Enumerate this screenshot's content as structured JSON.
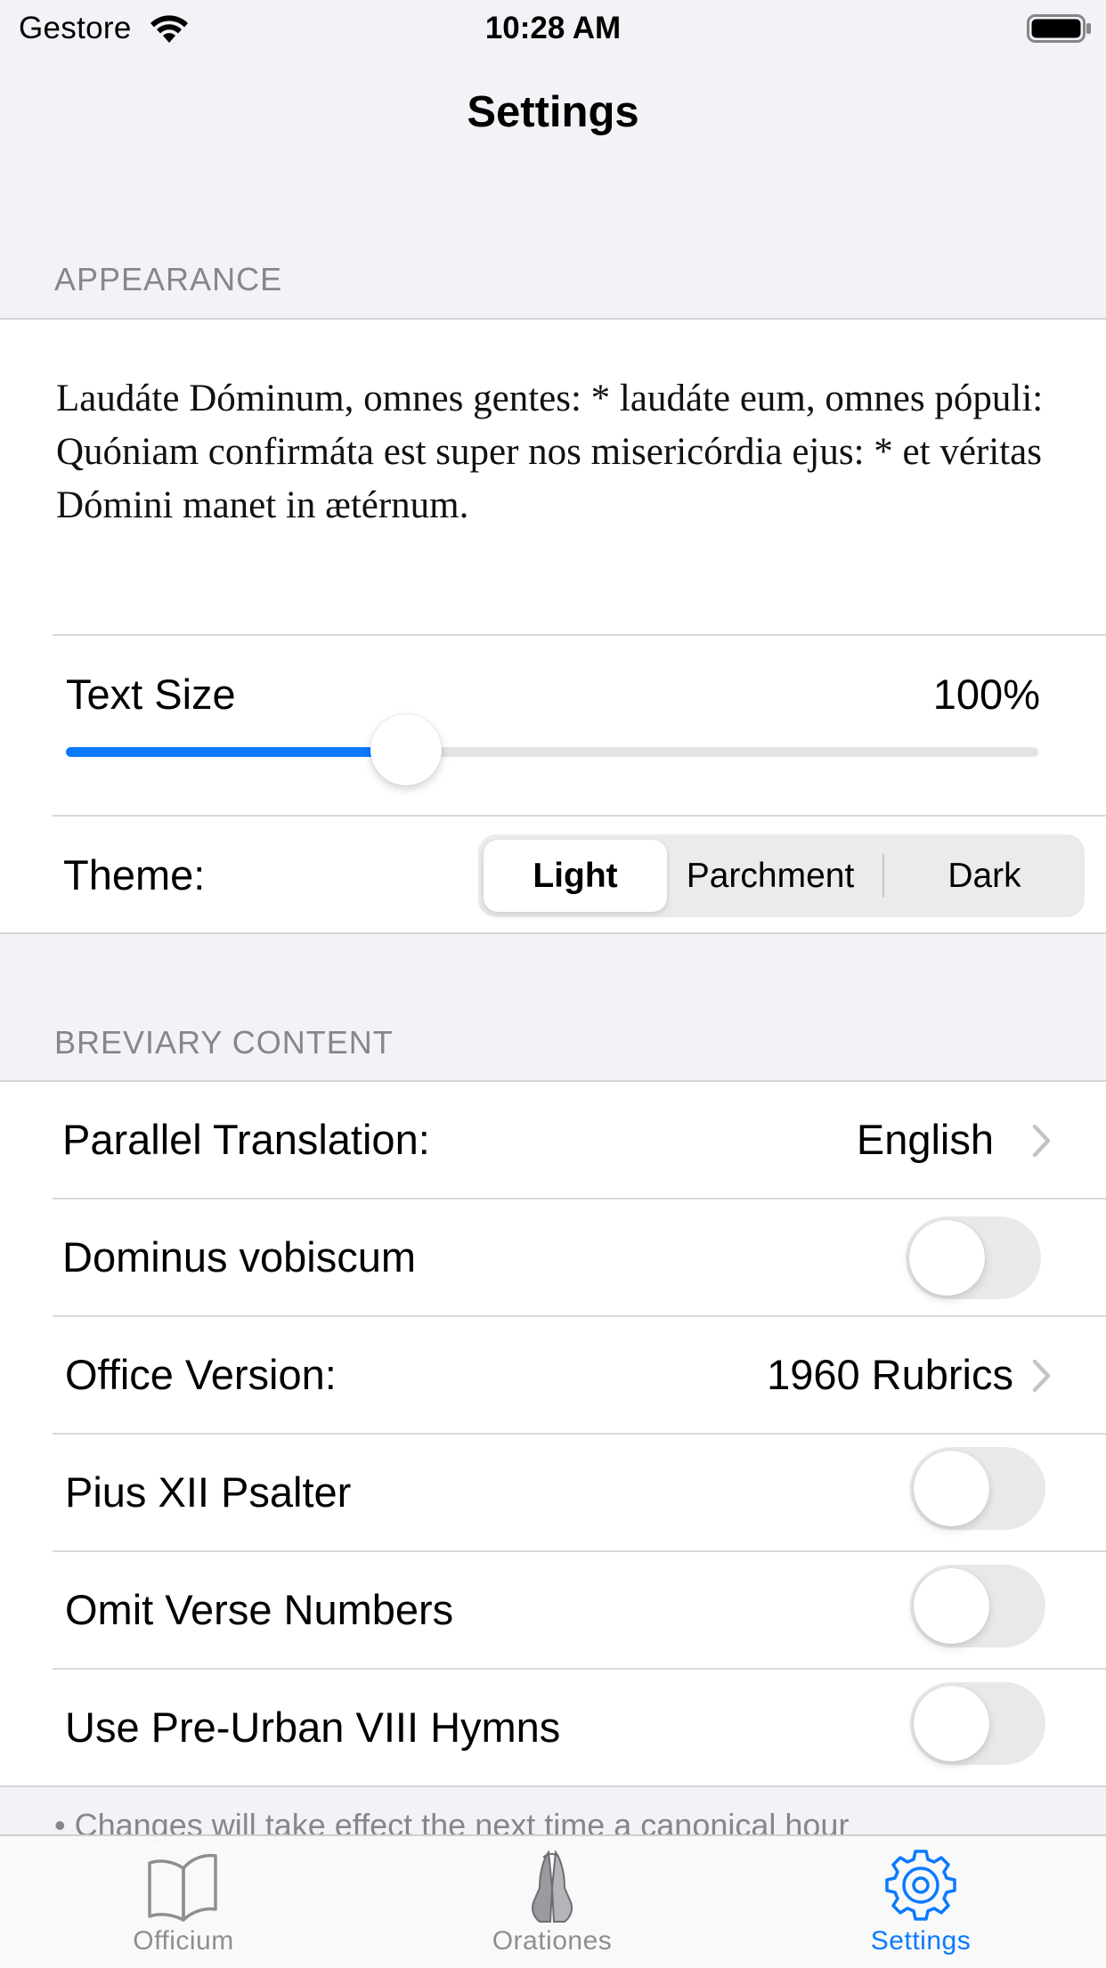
{
  "status_bar": {
    "carrier": "Gestore",
    "time": "10:28 AM",
    "icons": [
      "wifi-icon",
      "battery-icon"
    ]
  },
  "nav": {
    "title": "Settings"
  },
  "appearance": {
    "header": "APPEARANCE",
    "preview_lines": [
      "Laudáte Dóminum, omnes gentes: * laudáte eum, omnes pópuli:",
      "Quóniam confirmáta est super nos misericórdia ejus: * et véritas Dómini manet in ætérnum."
    ],
    "text_size": {
      "label": "Text Size",
      "value_text": "100%",
      "slider_fraction": 0.35
    },
    "theme": {
      "label": "Theme:",
      "options": [
        "Light",
        "Parchment",
        "Dark"
      ],
      "selected": "Light"
    }
  },
  "breviary": {
    "header": "BREVIARY CONTENT",
    "parallel_translation": {
      "label": "Parallel Translation:",
      "value": "English"
    },
    "dominus_vobiscum": {
      "label": "Dominus vobiscum",
      "on": false
    },
    "office_version": {
      "label": "Office Version:",
      "value": "1960 Rubrics"
    },
    "pius_psalter": {
      "label": "Pius XII Psalter",
      "on": false
    },
    "omit_verse_numbers": {
      "label": "Omit Verse Numbers",
      "on": false
    },
    "pre_urban_hymns": {
      "label": "Use Pre-Urban VIII Hymns",
      "on": false
    }
  },
  "footer_note": "• Changes will take effect the next time a canonical hour",
  "tabbar": {
    "tabs": [
      {
        "label": "Officium",
        "icon": "book-icon"
      },
      {
        "label": "Orationes",
        "icon": "praying-hands-icon"
      },
      {
        "label": "Settings",
        "icon": "gear-icon"
      }
    ],
    "active": "Settings"
  },
  "colors": {
    "accent": "#0A7AFF",
    "background": "#F2F2F7",
    "secondary_text": "#86868B",
    "toggle_off": "#E9E9EA"
  }
}
